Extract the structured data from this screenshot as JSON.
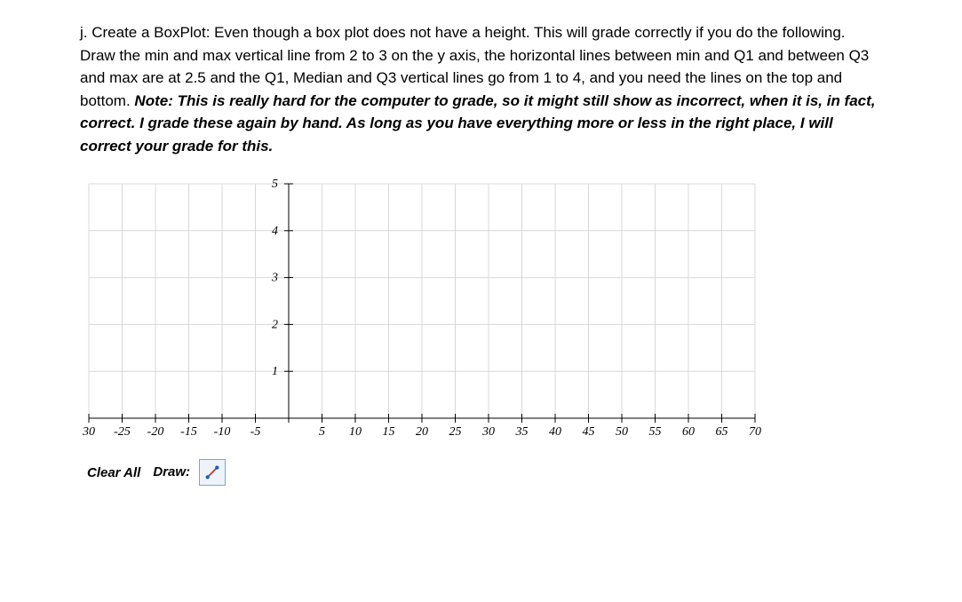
{
  "instruction": {
    "main": "j. Create a BoxPlot: Even though a box plot does not have a height. This will grade correctly if you do the following.  Draw the min and max vertical line from 2 to 3 on the y axis, the horizontal lines between min and Q1 and between Q3 and max are at 2.5 and the Q1, Median and Q3 vertical lines go from 1 to 4, and you need the lines on the top and bottom. ",
    "note_prefix": "Note: This is really hard for the computer to grade, so it might still show as incorrect, when it is, in fact, correct. I grade these again by hand. As long as you have everything more or less in the right place, I will correct your grade for this."
  },
  "controls": {
    "clear_label": "Clear All",
    "draw_label": "Draw:"
  },
  "chart_data": {
    "type": "other",
    "subtype": "empty-cartesian-grid-for-boxplot",
    "xlabel": "",
    "ylabel": "",
    "title": "",
    "x_ticks": [
      -30,
      -25,
      -20,
      -15,
      -10,
      -5,
      0,
      5,
      10,
      15,
      20,
      25,
      30,
      35,
      40,
      45,
      50,
      55,
      60,
      65,
      70
    ],
    "x_tick_labels": [
      "30",
      "-25",
      "-20",
      "-15",
      "-10",
      "-5",
      "",
      "5",
      "10",
      "15",
      "20",
      "25",
      "30",
      "35",
      "40",
      "45",
      "50",
      "55",
      "60",
      "65",
      "70"
    ],
    "y_ticks": [
      1,
      2,
      3,
      4,
      5
    ],
    "xlim": [
      -30,
      70
    ],
    "ylim": [
      0,
      5
    ],
    "series": []
  }
}
